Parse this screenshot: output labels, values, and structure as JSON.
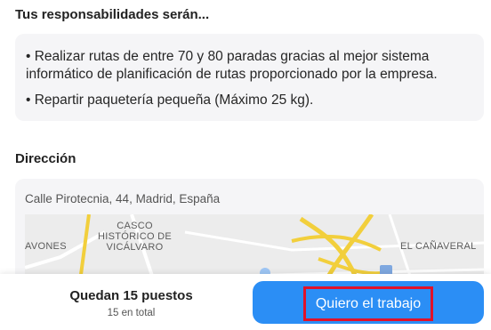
{
  "responsibilities": {
    "title": "Tus responsabilidades serán...",
    "items": [
      "• Realizar rutas de entre 70 y 80 paradas gracias al mejor sistema informático de planificación de rutas proporcionado por la empresa.",
      "• Repartir paquetería pequeña (Máximo 25 kg)."
    ]
  },
  "address": {
    "title": "Dirección",
    "value": "Calle Pirotecnia, 44, Madrid, España",
    "map_labels": {
      "casco_line1": "CASCO",
      "casco_line2": "HISTÓRICO DE",
      "casco_line3": "VICÁLVARO",
      "avones": "AVONES",
      "canaveral": "EL CAÑAVERAL"
    }
  },
  "footer": {
    "seats_main": "Quedan 15 puestos",
    "seats_sub": "15 en total",
    "cta_label": "Quiero el trabajo"
  },
  "colors": {
    "cta": "#2b8ef5",
    "highlight": "#e0122a",
    "road_major": "#f2cf3c"
  }
}
